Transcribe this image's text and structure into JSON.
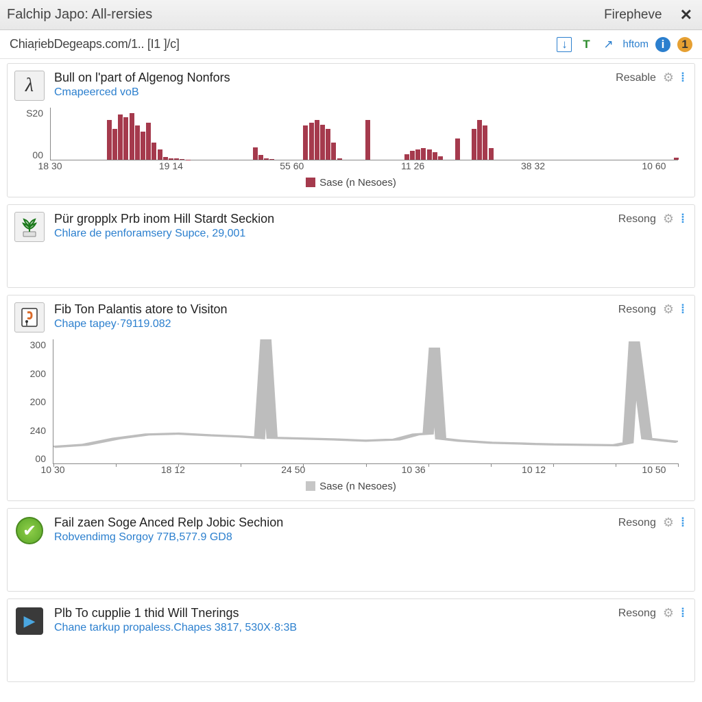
{
  "window": {
    "title": "Falchip Japo: All-rersies",
    "aux_label": "Firepheve",
    "close_glyph": "✕"
  },
  "toolbar": {
    "breadcrumb": "ChiaŗiebDegeaps.com/1.. [I1 ]/c]",
    "icons": {
      "download": "↓",
      "t_label": "T",
      "refresh": "↗",
      "hftom": "hftom",
      "info": "i",
      "badge": "1"
    }
  },
  "cards": [
    {
      "icon": "lambda",
      "title": "Bull on l'part of Algenog Nonfors",
      "subtitle": "Cmapeerced voB",
      "status": "Resable"
    },
    {
      "icon": "plant",
      "title": "Pür gropplx Prb inom Hill Stardt Seckion",
      "subtitle": "Chlare de penforamsery Supce, 29,001",
      "status": "Resong"
    },
    {
      "icon": "doc",
      "title": "Fib Ton Palantis atore to Visiton",
      "subtitle": "Chape tapey·79119.082",
      "status": "Resong"
    },
    {
      "icon": "check",
      "title": "Fail zaen Soge Anced Relp Jobic Sechion",
      "subtitle": "Robvendimg Sorgoy 77B,577.9 GD8",
      "status": "Resong"
    },
    {
      "icon": "media",
      "title": "Plb To cupplie 1 thid Will Tnerings",
      "subtitle": "Chane tarkup propaless.Chapes 3817, 530X·8:3B",
      "status": "Resong"
    }
  ],
  "chart_data": [
    {
      "type": "bar",
      "title": "",
      "ylabel": "",
      "xlabel": "",
      "ylim": [
        0,
        920
      ],
      "y_ticks": [
        "S20",
        "00"
      ],
      "x_ticks": [
        "18 30",
        "19 14",
        "55 60",
        "11 26",
        "38 32",
        "10 60"
      ],
      "legend": "Sase (n Nesoes)",
      "color": "#a53a4d",
      "values": [
        0,
        0,
        0,
        0,
        0,
        0,
        0,
        0,
        0,
        0,
        700,
        550,
        800,
        750,
        820,
        600,
        500,
        650,
        300,
        180,
        50,
        30,
        20,
        10,
        5,
        0,
        0,
        0,
        0,
        0,
        0,
        0,
        0,
        0,
        0,
        0,
        220,
        80,
        30,
        10,
        0,
        0,
        0,
        0,
        0,
        600,
        650,
        700,
        620,
        550,
        300,
        20,
        0,
        0,
        0,
        0,
        700,
        0,
        0,
        0,
        0,
        0,
        0,
        100,
        160,
        180,
        200,
        180,
        130,
        60,
        0,
        0,
        380,
        0,
        0,
        550,
        700,
        600,
        200,
        0,
        0,
        0,
        0,
        0,
        0,
        0,
        0,
        0,
        0,
        0,
        0,
        0,
        0,
        0,
        0,
        0,
        0,
        0,
        0,
        0,
        0,
        0,
        0,
        0,
        0,
        0,
        0,
        0,
        0,
        0,
        0,
        40
      ]
    },
    {
      "type": "line",
      "title": "",
      "ylabel": "",
      "xlabel": "",
      "ylim": [
        0,
        300
      ],
      "y_ticks": [
        "300",
        "200",
        "200",
        "240",
        "00"
      ],
      "x_ticks": [
        "10 30",
        "18 12",
        "24 50",
        "10 36",
        "10 12",
        "10 50"
      ],
      "legend": "Sase (n Nesoes)",
      "color": "#bdbdbd",
      "series": [
        {
          "name": "Sase",
          "x": [
            0,
            5,
            10,
            15,
            20,
            25,
            30,
            33,
            34,
            35,
            40,
            45,
            50,
            55,
            58,
            60,
            61,
            62,
            65,
            70,
            75,
            77,
            80,
            85,
            90,
            92,
            93,
            95,
            98,
            100
          ],
          "y": [
            40,
            45,
            60,
            70,
            72,
            68,
            65,
            62,
            300,
            62,
            60,
            58,
            55,
            58,
            70,
            72,
            280,
            60,
            55,
            50,
            48,
            47,
            46,
            45,
            44,
            50,
            295,
            60,
            55,
            52
          ]
        }
      ]
    }
  ]
}
